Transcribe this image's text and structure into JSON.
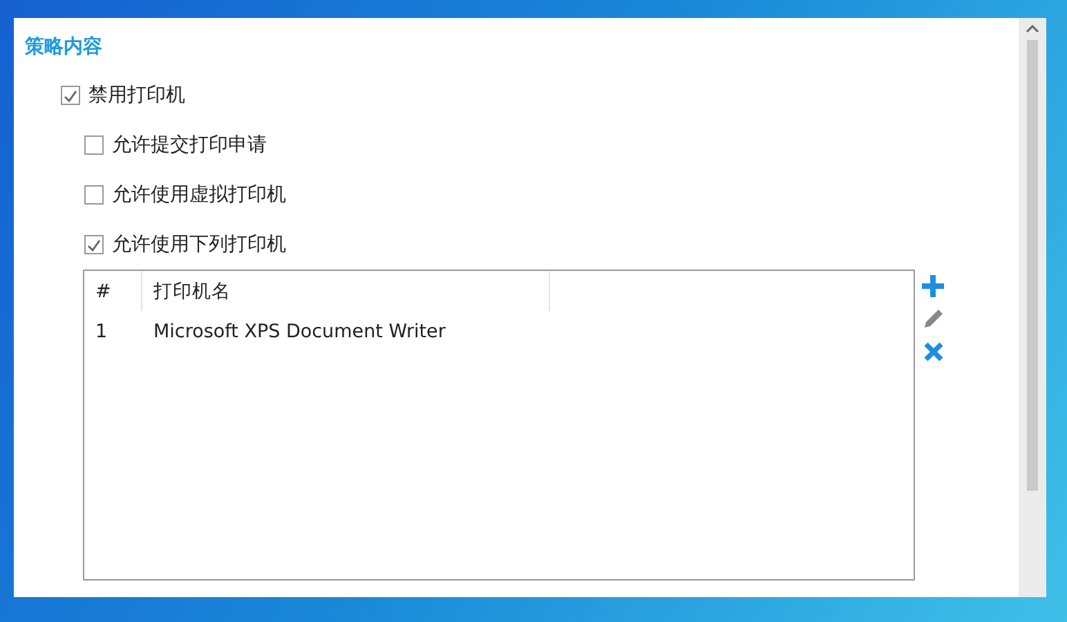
{
  "section": {
    "title": "策略内容"
  },
  "options": [
    {
      "label": "禁用打印机",
      "checked": true,
      "children": [
        {
          "label": "允许提交打印申请",
          "checked": false
        },
        {
          "label": "允许使用虚拟打印机",
          "checked": false
        },
        {
          "label": "允许使用下列打印机",
          "checked": true
        }
      ]
    }
  ],
  "table": {
    "columns": [
      "#",
      "打印机名"
    ],
    "rows": [
      {
        "cells": [
          "1",
          "Microsoft XPS Document Writer"
        ]
      }
    ]
  },
  "toolbar": [
    {
      "kind": "add"
    },
    {
      "kind": "edit"
    },
    {
      "kind": "delete"
    }
  ]
}
